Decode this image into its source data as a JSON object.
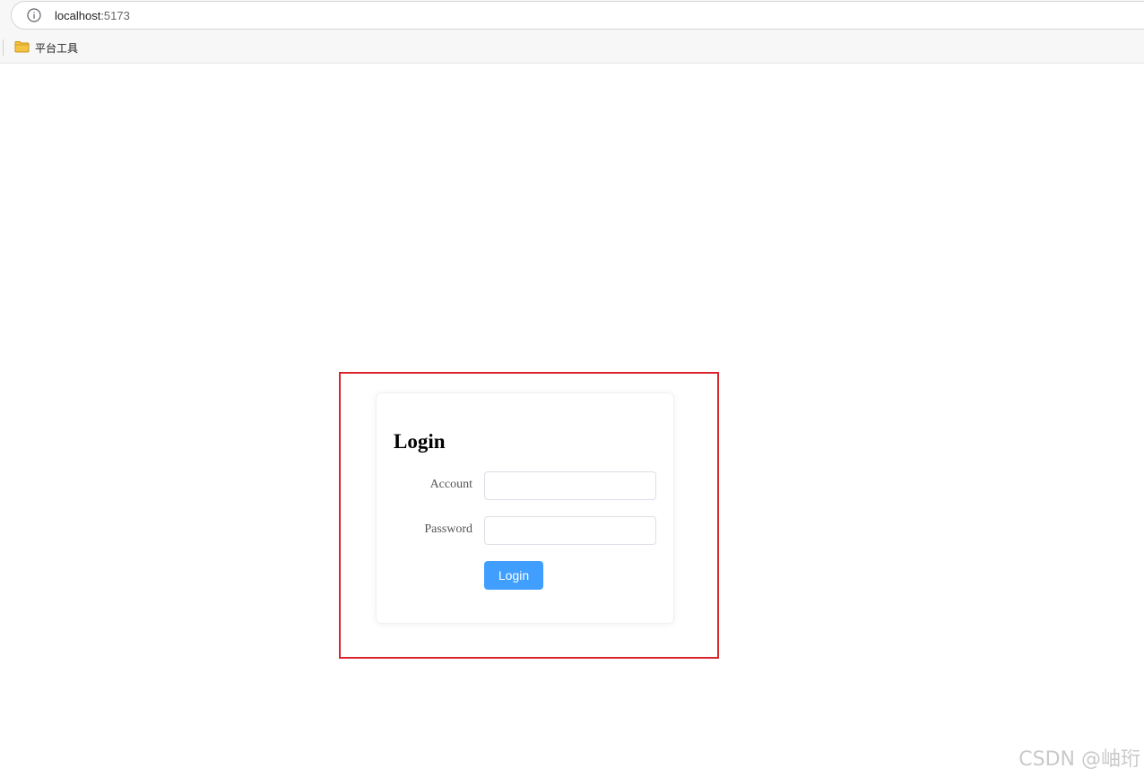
{
  "browser": {
    "url_host": "localhost",
    "url_port": ":5173",
    "bookmarks": [
      {
        "label": "平台工具",
        "icon": "folder-icon"
      }
    ]
  },
  "login": {
    "title": "Login",
    "account_label": "Account",
    "account_value": "",
    "password_label": "Password",
    "password_value": "",
    "button_label": "Login"
  },
  "watermark": "CSDN @岫珩",
  "colors": {
    "primary_button": "#409eff",
    "highlight_border": "#d9262c",
    "folder": "#f5c342"
  }
}
